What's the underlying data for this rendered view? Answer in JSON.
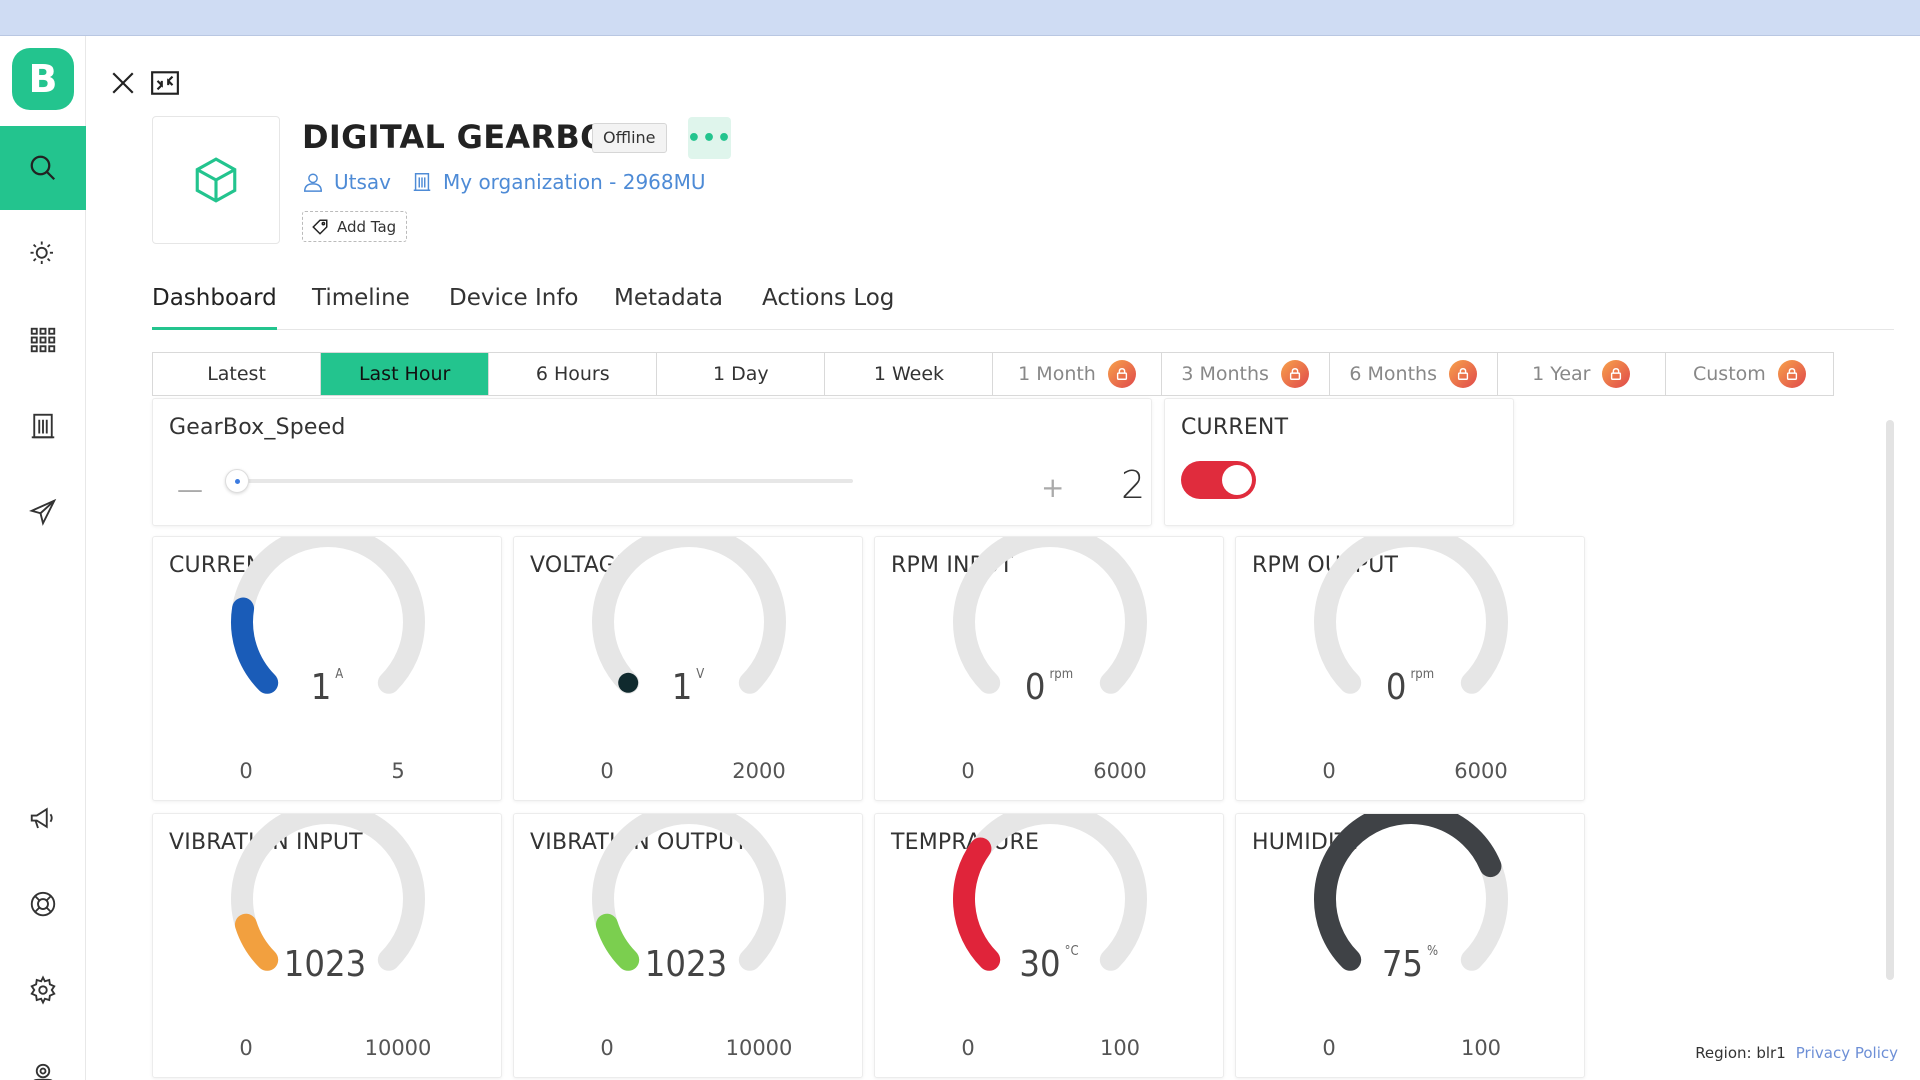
{
  "sidebar": {
    "logo_letter": "B",
    "items": [
      {
        "icon": "search-icon",
        "active": true
      },
      {
        "icon": "sun-user-icon",
        "active": false
      },
      {
        "icon": "apps-grid-icon",
        "active": false
      },
      {
        "icon": "building-icon",
        "active": false
      },
      {
        "icon": "send-icon",
        "active": false
      },
      {
        "icon": "megaphone-icon",
        "active": false
      },
      {
        "icon": "lifebuoy-icon",
        "active": false
      },
      {
        "icon": "gear-icon",
        "active": false
      },
      {
        "icon": "user-badge-icon",
        "active": false
      }
    ]
  },
  "device": {
    "title": "DIGITAL GEARBOX",
    "status": "Offline",
    "more_label": "•••",
    "owner": "Utsav",
    "organization": "My organization - 2968MU",
    "add_tag": "Add Tag"
  },
  "tabs": [
    "Dashboard",
    "Timeline",
    "Device Info",
    "Metadata",
    "Actions Log"
  ],
  "active_tab": "Dashboard",
  "time_range": {
    "options": [
      "Latest",
      "Last Hour",
      "6 Hours",
      "1 Day",
      "1 Week",
      "1 Month",
      "3 Months",
      "6 Months",
      "1 Year",
      "Custom"
    ],
    "active": "Last Hour",
    "locked": [
      "1 Month",
      "3 Months",
      "6 Months",
      "1 Year",
      "Custom"
    ]
  },
  "slider_widget": {
    "title": "GearBox_Speed",
    "minus": "—",
    "plus": "+",
    "value": "2",
    "position": 0.02
  },
  "switch_widget": {
    "title": "CURRENT",
    "state": "on"
  },
  "gauges": [
    {
      "title": "CURRENT",
      "value": "1",
      "unit": "A",
      "min": "0",
      "max": "5",
      "fraction": 0.2,
      "color": "#1a5cb8"
    },
    {
      "title": "VOLTAGE",
      "value": "1",
      "unit": "V",
      "min": "0",
      "max": "2000",
      "fraction": 0.0005,
      "color": "#102a2e"
    },
    {
      "title": "RPM INPUT",
      "value": "0",
      "unit": "rpm",
      "min": "0",
      "max": "6000",
      "fraction": 0,
      "color": "#999999"
    },
    {
      "title": "RPM OUTPUT",
      "value": "0",
      "unit": "rpm",
      "min": "0",
      "max": "6000",
      "fraction": 0,
      "color": "#999999"
    },
    {
      "title": "VIBRATION INPUT",
      "value": "1023",
      "unit": "",
      "min": "0",
      "max": "10000",
      "fraction": 0.1023,
      "color": "#f2a03f"
    },
    {
      "title": "VIBRATION OUTPUT",
      "value": "1023",
      "unit": "",
      "min": "0",
      "max": "10000",
      "fraction": 0.1023,
      "color": "#7bcf4f"
    },
    {
      "title": "TEMPRATURE",
      "value": "30",
      "unit": "°C",
      "min": "0",
      "max": "100",
      "fraction": 0.3,
      "color": "#e0243a"
    },
    {
      "title": "HUMIDITY",
      "value": "75",
      "unit": "%",
      "min": "0",
      "max": "100",
      "fraction": 0.75,
      "color": "#3f4246"
    }
  ],
  "footer": {
    "region": "Region: blr1",
    "privacy": "Privacy Policy"
  }
}
